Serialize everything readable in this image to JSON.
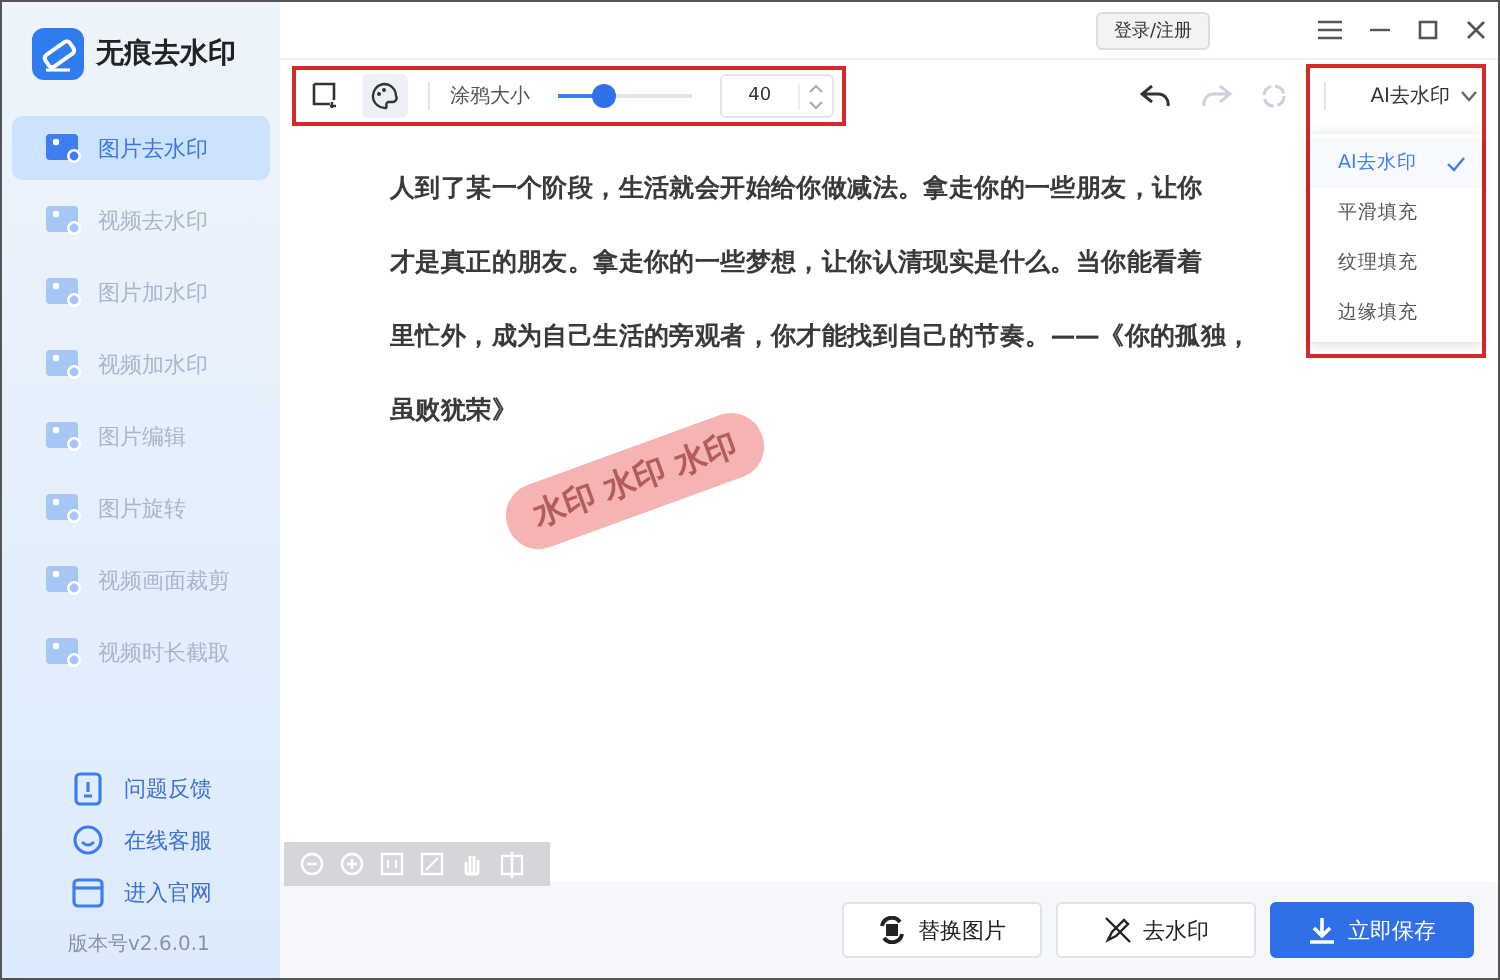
{
  "app": {
    "title": "无痕去水印"
  },
  "sidebar": {
    "items": [
      {
        "label": "图片去水印",
        "selected": true
      },
      {
        "label": "视频去水印",
        "selected": false
      },
      {
        "label": "图片加水印",
        "selected": false
      },
      {
        "label": "视频加水印",
        "selected": false
      },
      {
        "label": "图片编辑",
        "selected": false
      },
      {
        "label": "图片旋转",
        "selected": false
      },
      {
        "label": "视频画面裁剪",
        "selected": false
      },
      {
        "label": "视频时长截取",
        "selected": false
      }
    ],
    "links": [
      {
        "label": "问题反馈",
        "kind": "feedback"
      },
      {
        "label": "在线客服",
        "kind": "chat"
      },
      {
        "label": "进入官网",
        "kind": "web"
      }
    ],
    "version": "版本号v2.6.0.1"
  },
  "titlebar": {
    "login_button": "登录/注册"
  },
  "toolbar": {
    "tools": [
      {
        "kind": "select",
        "selected": false
      },
      {
        "kind": "brush",
        "selected": true
      }
    ],
    "brush_label": "涂鸦大小",
    "brush_size": {
      "level": 0.35
    },
    "size_value": "40",
    "mode_select": "AI去水印"
  },
  "mode_menu": [
    {
      "label": "AI去水印",
      "selected": true
    },
    {
      "label": "平滑填充",
      "selected": false
    },
    {
      "label": "纹理填充",
      "selected": false
    },
    {
      "label": "边缘填充",
      "selected": false
    }
  ],
  "document": {
    "lines": [
      "人到了某一个阶段，生活就会开始给你做减法。拿走你的一些朋友，让你",
      "才是真正的朋友。拿走你的一些梦想，让你认清现实是什么。当你能看着",
      "里忙外，成为自己生活的旁观者，你才能找到自己的节奏。——《你的孤独，",
      "虽败犹荣》"
    ],
    "watermark": "水印 水印 水印"
  },
  "actions": [
    {
      "label": "替换图片",
      "kind": "replace"
    },
    {
      "label": "去水印",
      "kind": "remove"
    },
    {
      "label": "立即保存",
      "kind": "save"
    }
  ]
}
